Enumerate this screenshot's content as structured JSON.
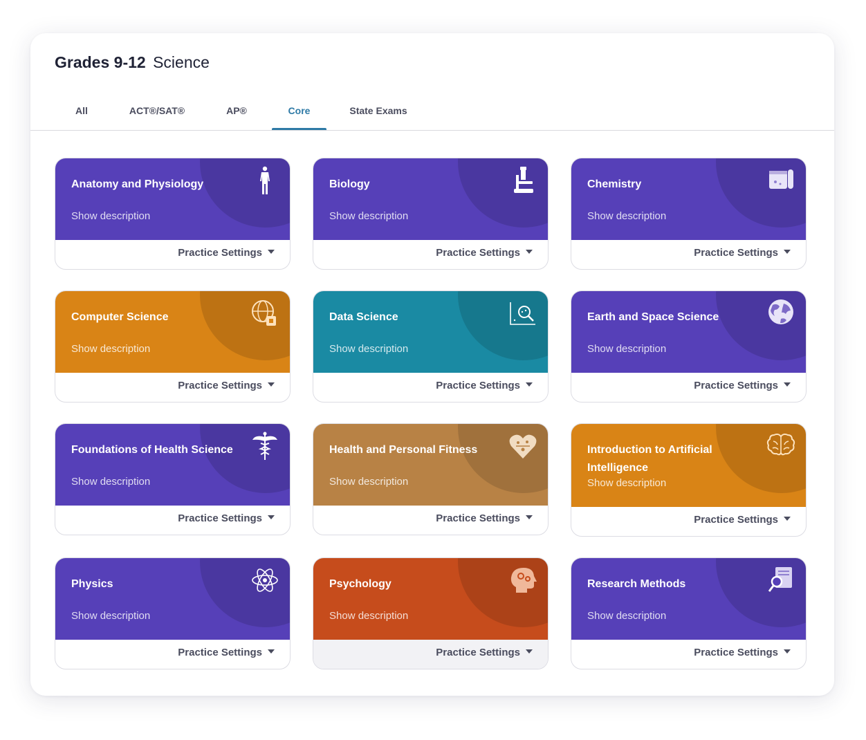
{
  "header": {
    "grade": "Grades 9-12",
    "subject": "Science"
  },
  "tabs": [
    {
      "label": "All",
      "active": false
    },
    {
      "label": "ACT®/SAT®",
      "active": false
    },
    {
      "label": "AP®",
      "active": false
    },
    {
      "label": "Core",
      "active": true
    },
    {
      "label": "State Exams",
      "active": false
    }
  ],
  "colors": {
    "purple": "#5640b8",
    "orange": "#d98416",
    "teal": "#1a8aa3",
    "brown": "#b88245",
    "red_orange": "#c64c1c",
    "active_tab": "#2e7aa6"
  },
  "cards": [
    {
      "title": "Anatomy and Physiology",
      "description_link": "Show description",
      "settings_label": "Practice Settings",
      "color": "#5640b8",
      "icon": "human-body-icon"
    },
    {
      "title": "Biology",
      "description_link": "Show description",
      "settings_label": "Practice Settings",
      "color": "#5640b8",
      "icon": "microscope-icon"
    },
    {
      "title": "Chemistry",
      "description_link": "Show description",
      "settings_label": "Practice Settings",
      "color": "#5640b8",
      "icon": "test-tubes-icon"
    },
    {
      "title": "Computer Science",
      "description_link": "Show description",
      "settings_label": "Practice Settings",
      "color": "#d98416",
      "icon": "globe-chip-icon"
    },
    {
      "title": "Data Science",
      "description_link": "Show description",
      "settings_label": "Practice Settings",
      "color": "#1a8aa3",
      "icon": "graph-magnifier-icon"
    },
    {
      "title": "Earth and Space Science",
      "description_link": "Show description",
      "settings_label": "Practice Settings",
      "color": "#5640b8",
      "icon": "earth-icon"
    },
    {
      "title": "Foundations of Health Science",
      "description_link": "Show description",
      "settings_label": "Practice Settings",
      "color": "#5640b8",
      "icon": "caduceus-icon"
    },
    {
      "title": "Health and Personal Fitness",
      "description_link": "Show description",
      "settings_label": "Practice Settings",
      "color": "#b88245",
      "icon": "fitness-heart-icon"
    },
    {
      "title": "Introduction to Artificial Intelligence",
      "description_link": "Show description",
      "settings_label": "Practice Settings",
      "color": "#d98416",
      "icon": "brain-icon"
    },
    {
      "title": "Physics",
      "description_link": "Show description",
      "settings_label": "Practice Settings",
      "color": "#5640b8",
      "icon": "atom-icon"
    },
    {
      "title": "Psychology",
      "description_link": "Show description",
      "settings_label": "Practice Settings",
      "color": "#c64c1c",
      "icon": "head-gears-icon"
    },
    {
      "title": "Research Methods",
      "description_link": "Show description",
      "settings_label": "Practice Settings",
      "color": "#5640b8",
      "icon": "document-search-icon"
    }
  ]
}
